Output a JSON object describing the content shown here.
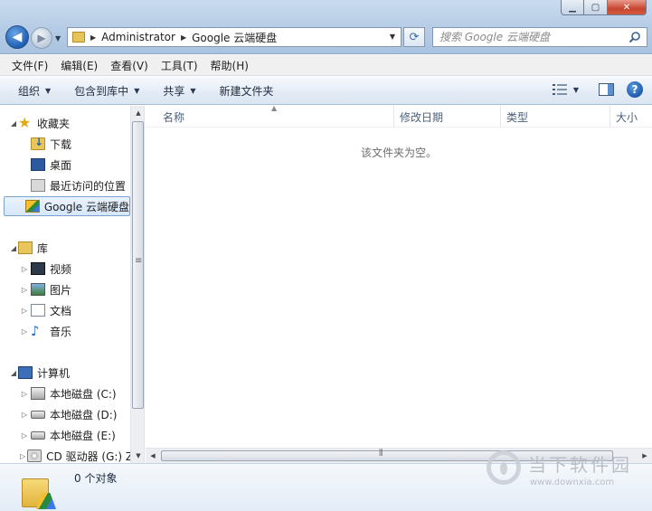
{
  "window": {
    "controls": {
      "minimize": "▁",
      "maximize": "▢",
      "close": "✕"
    }
  },
  "address_bar": {
    "segments": [
      "Administrator",
      "Google 云端硬盘"
    ]
  },
  "search": {
    "placeholder": "搜索 Google 云端硬盘"
  },
  "menu": {
    "items": [
      "文件(F)",
      "编辑(E)",
      "查看(V)",
      "工具(T)",
      "帮助(H)"
    ]
  },
  "commands": {
    "organize": "组织",
    "include_in_library": "包含到库中",
    "share": "共享",
    "new_folder": "新建文件夹"
  },
  "nav": {
    "favorites": {
      "label": "收藏夹",
      "items": [
        "下载",
        "桌面",
        "最近访问的位置",
        "Google 云端硬盘"
      ]
    },
    "libraries": {
      "label": "库",
      "items": [
        "视频",
        "图片",
        "文档",
        "音乐"
      ]
    },
    "computer": {
      "label": "计算机",
      "items": [
        "本地磁盘 (C:)",
        "本地磁盘 (D:)",
        "本地磁盘 (E:)",
        "CD 驱动器 (G:) Z"
      ]
    }
  },
  "columns": [
    "名称",
    "修改日期",
    "类型",
    "大小"
  ],
  "content": {
    "empty_message": "该文件夹为空。"
  },
  "details": {
    "count": "0 个对象"
  },
  "watermark": {
    "title": "当下软件园",
    "url": "www.downxia.com"
  }
}
